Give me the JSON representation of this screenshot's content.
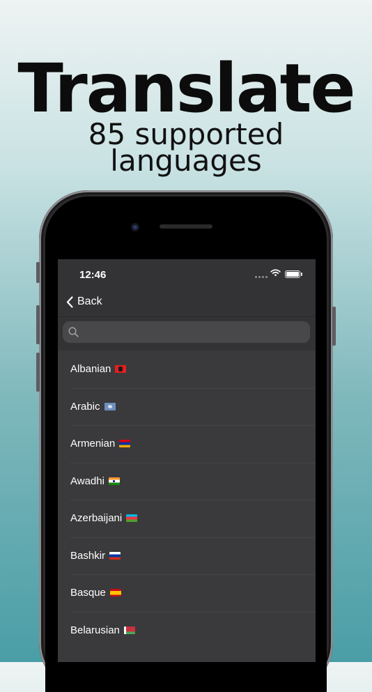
{
  "promo": {
    "headline": "Translate",
    "subline_1": "85 supported",
    "subline_2": "languages"
  },
  "status_bar": {
    "time": "12:46"
  },
  "nav": {
    "back_label": "Back"
  },
  "search": {
    "placeholder": "",
    "value": ""
  },
  "languages": [
    {
      "label": "Albanian",
      "flag": "albania"
    },
    {
      "label": "Arabic",
      "flag": "arab-league"
    },
    {
      "label": "Armenian",
      "flag": "armenia"
    },
    {
      "label": "Awadhi",
      "flag": "india"
    },
    {
      "label": "Azerbaijani",
      "flag": "azerbaijan"
    },
    {
      "label": "Bashkir",
      "flag": "russia"
    },
    {
      "label": "Basque",
      "flag": "spain"
    },
    {
      "label": "Belarusian",
      "flag": "belarus"
    }
  ],
  "colors": {
    "screen_bg": "#3a3a3c",
    "bar_bg": "#333335",
    "search_bg": "#48484a",
    "text": "#ffffff",
    "background_top": "#eef3f3",
    "background_bottom": "#4a9ea6"
  }
}
